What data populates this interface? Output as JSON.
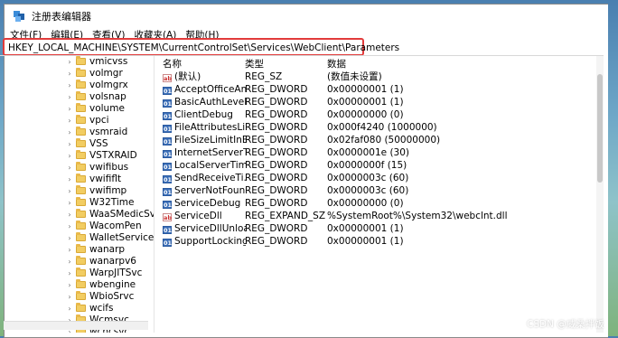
{
  "window": {
    "title": "注册表编辑器"
  },
  "menu": {
    "items": [
      "文件(F)",
      "编辑(E)",
      "查看(V)",
      "收藏夹(A)",
      "帮助(H)"
    ]
  },
  "address": {
    "path": "HKEY_LOCAL_MACHINE\\SYSTEM\\CurrentControlSet\\Services\\WebClient\\Parameters"
  },
  "tree": {
    "items": [
      "vmicvss",
      "volmgr",
      "volmgrx",
      "volsnap",
      "volume",
      "vpci",
      "vsmraid",
      "VSS",
      "VSTXRAID",
      "vwifibus",
      "vwififlt",
      "vwifimp",
      "W32Time",
      "WaaSMedicSvc",
      "WacomPen",
      "WalletService",
      "wanarp",
      "wanarpv6",
      "WarpJITSvc",
      "wbengine",
      "WbioSrvc",
      "wcifs",
      "Wcmsvc",
      "wcncsvc"
    ]
  },
  "list": {
    "headers": {
      "name": "名称",
      "type": "类型",
      "data": "数据"
    },
    "rows": [
      {
        "name": "(默认)",
        "type": "REG_SZ",
        "data": "(数值未设置)",
        "icon": "string-value-icon"
      },
      {
        "name": "AcceptOfficeAn...",
        "type": "REG_DWORD",
        "data": "0x00000001 (1)",
        "icon": "binary-value-icon"
      },
      {
        "name": "BasicAuthLevel",
        "type": "REG_DWORD",
        "data": "0x00000001 (1)",
        "icon": "binary-value-icon"
      },
      {
        "name": "ClientDebug",
        "type": "REG_DWORD",
        "data": "0x00000000 (0)",
        "icon": "binary-value-icon"
      },
      {
        "name": "FileAttributesLi...",
        "type": "REG_DWORD",
        "data": "0x000f4240 (1000000)",
        "icon": "binary-value-icon"
      },
      {
        "name": "FileSizeLimitInB...",
        "type": "REG_DWORD",
        "data": "0x02faf080 (50000000)",
        "icon": "binary-value-icon"
      },
      {
        "name": "InternetServerTi...",
        "type": "REG_DWORD",
        "data": "0x0000001e (30)",
        "icon": "binary-value-icon"
      },
      {
        "name": "LocalServerTim...",
        "type": "REG_DWORD",
        "data": "0x0000000f (15)",
        "icon": "binary-value-icon"
      },
      {
        "name": "SendReceiveTi...",
        "type": "REG_DWORD",
        "data": "0x0000003c (60)",
        "icon": "binary-value-icon"
      },
      {
        "name": "ServerNotFoun...",
        "type": "REG_DWORD",
        "data": "0x0000003c (60)",
        "icon": "binary-value-icon"
      },
      {
        "name": "ServiceDebug",
        "type": "REG_DWORD",
        "data": "0x00000000 (0)",
        "icon": "binary-value-icon"
      },
      {
        "name": "ServiceDll",
        "type": "REG_EXPAND_SZ",
        "data": "%SystemRoot%\\System32\\webclnt.dll",
        "icon": "string-value-icon"
      },
      {
        "name": "ServiceDllUnloa...",
        "type": "REG_DWORD",
        "data": "0x00000001 (1)",
        "icon": "binary-value-icon"
      },
      {
        "name": "SupportLocking",
        "type": "REG_DWORD",
        "data": "0x00000001 (1)",
        "icon": "binary-value-icon"
      }
    ]
  },
  "watermark": "CSDN @威桑拌饭",
  "colors": {
    "highlight_box": "#e23b3b",
    "folder": "#f2cd62"
  }
}
